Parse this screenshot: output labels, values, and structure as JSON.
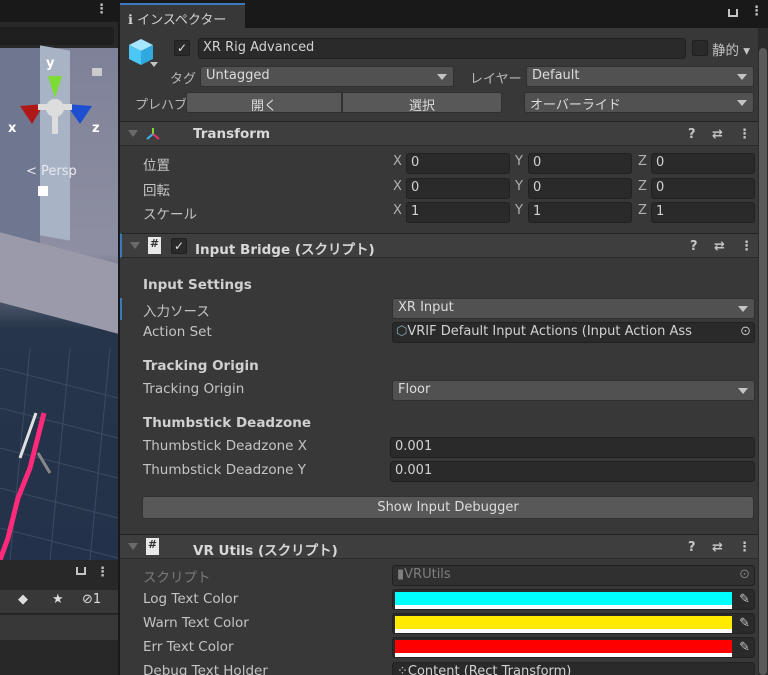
{
  "scene": {
    "gizmo_axes": {
      "y": "y",
      "x": "x",
      "z": "z"
    },
    "projection": "Persp"
  },
  "hierarchy": {
    "hidden_count": "1",
    "icons": [
      "tag-icon",
      "star-icon",
      "hidden-icon"
    ]
  },
  "inspector": {
    "tab_label": "インスペクター",
    "object": {
      "name": "XR Rig Advanced",
      "active": true,
      "static_label": "静的",
      "static": false,
      "tag_label": "タグ",
      "tag_value": "Untagged",
      "layer_label": "レイヤー",
      "layer_value": "Default",
      "prefab_label": "プレハブ",
      "open_button": "開く",
      "select_button": "選択",
      "overrides_label": "オーバーライド"
    },
    "transform": {
      "title": "Transform",
      "rows": [
        {
          "label": "位置",
          "x": "0",
          "y": "0",
          "z": "0"
        },
        {
          "label": "回転",
          "x": "0",
          "y": "0",
          "z": "0"
        },
        {
          "label": "スケール",
          "x": "1",
          "y": "1",
          "z": "1"
        }
      ],
      "axis_labels": {
        "x": "X",
        "y": "Y",
        "z": "Z"
      }
    },
    "input_bridge": {
      "title": "Input Bridge (スクリプト)",
      "enabled": true,
      "input_settings_heading": "Input Settings",
      "input_source_label": "入力ソース",
      "input_source_value": "XR Input",
      "action_set_label": "Action Set",
      "action_set_value": "VRIF Default Input Actions (Input Action Ass",
      "tracking_heading": "Tracking Origin",
      "tracking_label": "Tracking Origin",
      "tracking_value": "Floor",
      "deadzone_heading": "Thumbstick Deadzone",
      "deadzone_x_label": "Thumbstick Deadzone X",
      "deadzone_x_value": "0.001",
      "deadzone_y_label": "Thumbstick Deadzone Y",
      "deadzone_y_value": "0.001",
      "debugger_button": "Show Input Debugger"
    },
    "vr_utils": {
      "title": "VR Utils (スクリプト)",
      "script_label": "スクリプト",
      "script_value": "VRUtils",
      "log_label": "Log Text Color",
      "log_color": "#00ffff",
      "warn_label": "Warn Text Color",
      "warn_color": "#ffea00",
      "err_label": "Err Text Color",
      "err_color": "#ff0000",
      "holder_label": "Debug Text Holder",
      "holder_value": "Content (Rect Transform)"
    }
  }
}
